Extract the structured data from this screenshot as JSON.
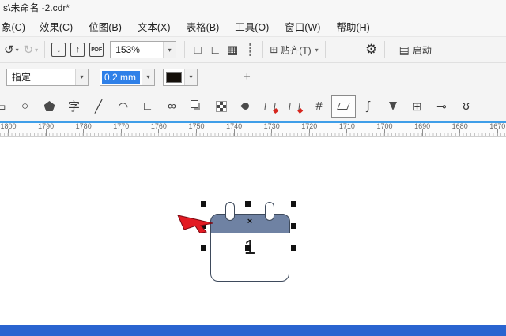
{
  "window": {
    "title": "s\\未命名 -2.cdr*"
  },
  "menubar": {
    "partial_item": "象(C)",
    "items": [
      "效果(C)",
      "位图(B)",
      "文本(X)",
      "表格(B)",
      "工具(O)",
      "窗口(W)",
      "帮助(H)"
    ]
  },
  "toolbar": {
    "undo_icon": "↺",
    "redo_icon": "↻",
    "caret": "▾",
    "import_icon": "↓",
    "export_icon": "↑",
    "pdf_label": "PDF",
    "zoom_value": "153%",
    "preview_icon": "□",
    "rulers_icon": "∟",
    "grid_icon": "▦",
    "guides_icon": "┊",
    "snap_icon": "⊞",
    "snap_label": "贴齐(T)",
    "options_icon": "⚙",
    "launch_icon": "▤",
    "launch_label": "启动"
  },
  "property_bar": {
    "outline_style_value": "指定",
    "outline_width_value": "0.2 mm",
    "add_label": "+"
  },
  "toolbox": {
    "tools": [
      {
        "name": "rectangle-tool",
        "glyph": "▭"
      },
      {
        "name": "ellipse-tool",
        "glyph": "○"
      },
      {
        "name": "polygon-tool",
        "shape": "pentagon"
      },
      {
        "name": "text-tool",
        "glyph": "字"
      },
      {
        "name": "freehand-tool",
        "glyph": "╱"
      },
      {
        "name": "bezier-tool",
        "glyph": "◠"
      },
      {
        "name": "connector-tool",
        "glyph": "∟"
      },
      {
        "name": "blend-tool",
        "glyph": "∞"
      },
      {
        "name": "order-tool",
        "shape": "stack"
      },
      {
        "name": "pattern-fill-tool",
        "shape": "checker"
      },
      {
        "name": "eyedropper-tool",
        "shape": "dropper"
      },
      {
        "name": "smart-fill-tool",
        "shape": "fillred"
      },
      {
        "name": "interactive-fill-tool",
        "shape": "fillred"
      },
      {
        "name": "mesh-fill-tool",
        "glyph": "#"
      },
      {
        "name": "eraser-tool",
        "shape": "eraser",
        "selected": true
      },
      {
        "name": "smudge-tool",
        "glyph": "∫"
      },
      {
        "name": "pen-tool",
        "shape": "nib"
      },
      {
        "name": "table-tool",
        "glyph": "⊞"
      },
      {
        "name": "attract-tool",
        "glyph": "⊸"
      },
      {
        "name": "spiral-tool",
        "glyph": "ʊ"
      }
    ]
  },
  "ruler": {
    "labels": [
      "1800",
      "1790",
      "1780",
      "1770",
      "1760",
      "1750",
      "1740",
      "1730",
      "1720",
      "1710",
      "1700",
      "1690",
      "1680",
      "1670"
    ]
  },
  "canvas": {
    "calendar_day": "1",
    "center_marker": "×"
  },
  "colors": {
    "accent_blue": "#3f9ee8",
    "selection_blue": "#2f80e8",
    "calendar_header": "#6f82a3",
    "taskbar_blue": "#2a64d0",
    "arrow_red": "#e31b23"
  }
}
